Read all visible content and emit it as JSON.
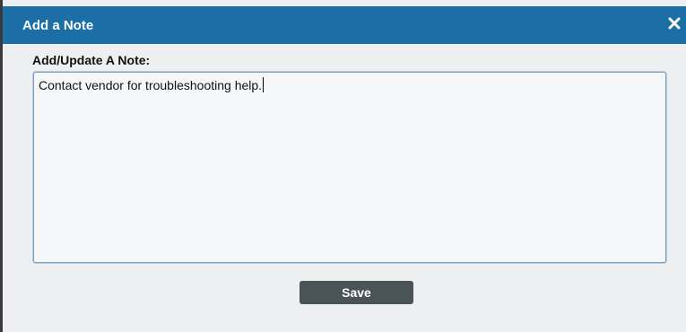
{
  "dialog": {
    "title": "Add a Note",
    "close_icon": "close-icon"
  },
  "note": {
    "label": "Add/Update A Note:",
    "value": "Contact vendor for troubleshooting help."
  },
  "actions": {
    "save_label": "Save"
  },
  "colors": {
    "titlebar": "#1b6fa6",
    "dialog_bg": "#eeeff0",
    "button_bg": "#4a5358",
    "textarea_border": "#7d9ec0"
  }
}
